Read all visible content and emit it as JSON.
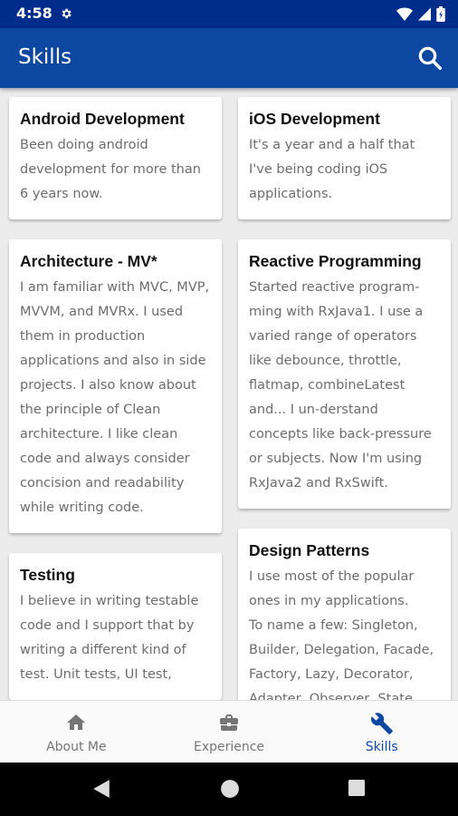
{
  "status_bar": {
    "time": "4:58"
  },
  "app_bar": {
    "title": "Skills"
  },
  "cards": {
    "left": [
      {
        "title": "Android Development",
        "body": "Been doing android development for more than 6 years now."
      },
      {
        "title": "Architecture - MV*",
        "body": "I am familiar with MVC, MVP, MVVM, and MVRx. I used them in production applications and also in side projects. I also know about the principle of Clean architecture. I like clean code and always consider concision and readability while writing code."
      },
      {
        "title": "Testing",
        "body": "I believe in writing testable code and I support that by writing a different kind of test. Unit tests, UI test,"
      }
    ],
    "right": [
      {
        "title": "iOS Development",
        "body": "It's a year and a half that I've being coding iOS applications."
      },
      {
        "title": "Reactive Programming",
        "body": "Started reactive program-ming with RxJava1. I use a varied range of operators like debounce, throttle, flatmap, combineLatest and... I un-derstand concepts like back-pressure or subjects. Now I'm using RxJava2 and RxSwift."
      },
      {
        "title": "Design Patterns",
        "body": "I use most of the popular ones in my applications.\nTo name a few: Singleton, Builder, Delegation, Facade, Factory, Lazy, Decorator, Adapter, Observer, State, Pool, etc..."
      }
    ]
  },
  "bottom_nav": {
    "items": [
      {
        "label": "About Me",
        "icon": "home-icon"
      },
      {
        "label": "Experience",
        "icon": "briefcase-icon"
      },
      {
        "label": "Skills",
        "icon": "wrench-icon",
        "active": true
      }
    ]
  },
  "colors": {
    "app_bar": "#0d47a1",
    "status_bar": "#002c8c",
    "active_tab": "#0d47a1",
    "inactive_tab": "#757575"
  }
}
